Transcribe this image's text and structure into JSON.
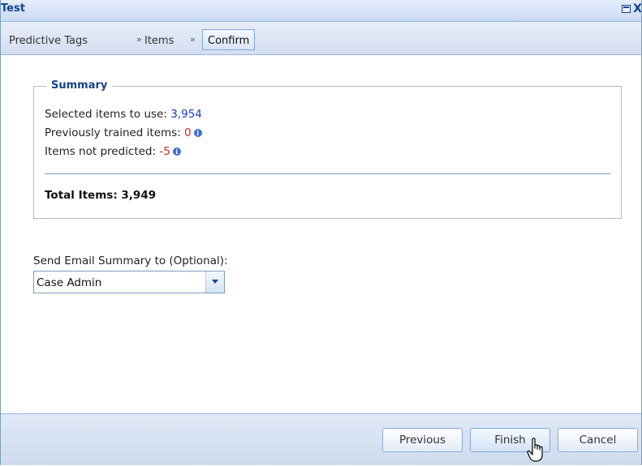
{
  "window": {
    "title": "Test",
    "max_glyph": "",
    "close_glyph": "X"
  },
  "breadcrumb": {
    "items": [
      "Predictive Tags",
      "Items",
      "Confirm"
    ],
    "separator": "»"
  },
  "summary": {
    "legend": "Summary",
    "selected_label": "Selected items to use: ",
    "selected_value": "3,954",
    "previous_label": "Previously trained items: ",
    "previous_value": "0",
    "not_predicted_label": "Items not predicted: ",
    "not_predicted_value": "-5",
    "total": "Total Items: 3,949"
  },
  "email": {
    "label": "Send Email Summary to (Optional):",
    "selected": "Case Admin"
  },
  "footer": {
    "previous_label": "Previous",
    "finish_label": "Finish",
    "cancel_label": "Cancel"
  },
  "colors": {
    "title_blue": "#15428b",
    "value_blue": "#1a39c8",
    "value_red": "#e02020",
    "info_icon": "#3c6cd8"
  }
}
